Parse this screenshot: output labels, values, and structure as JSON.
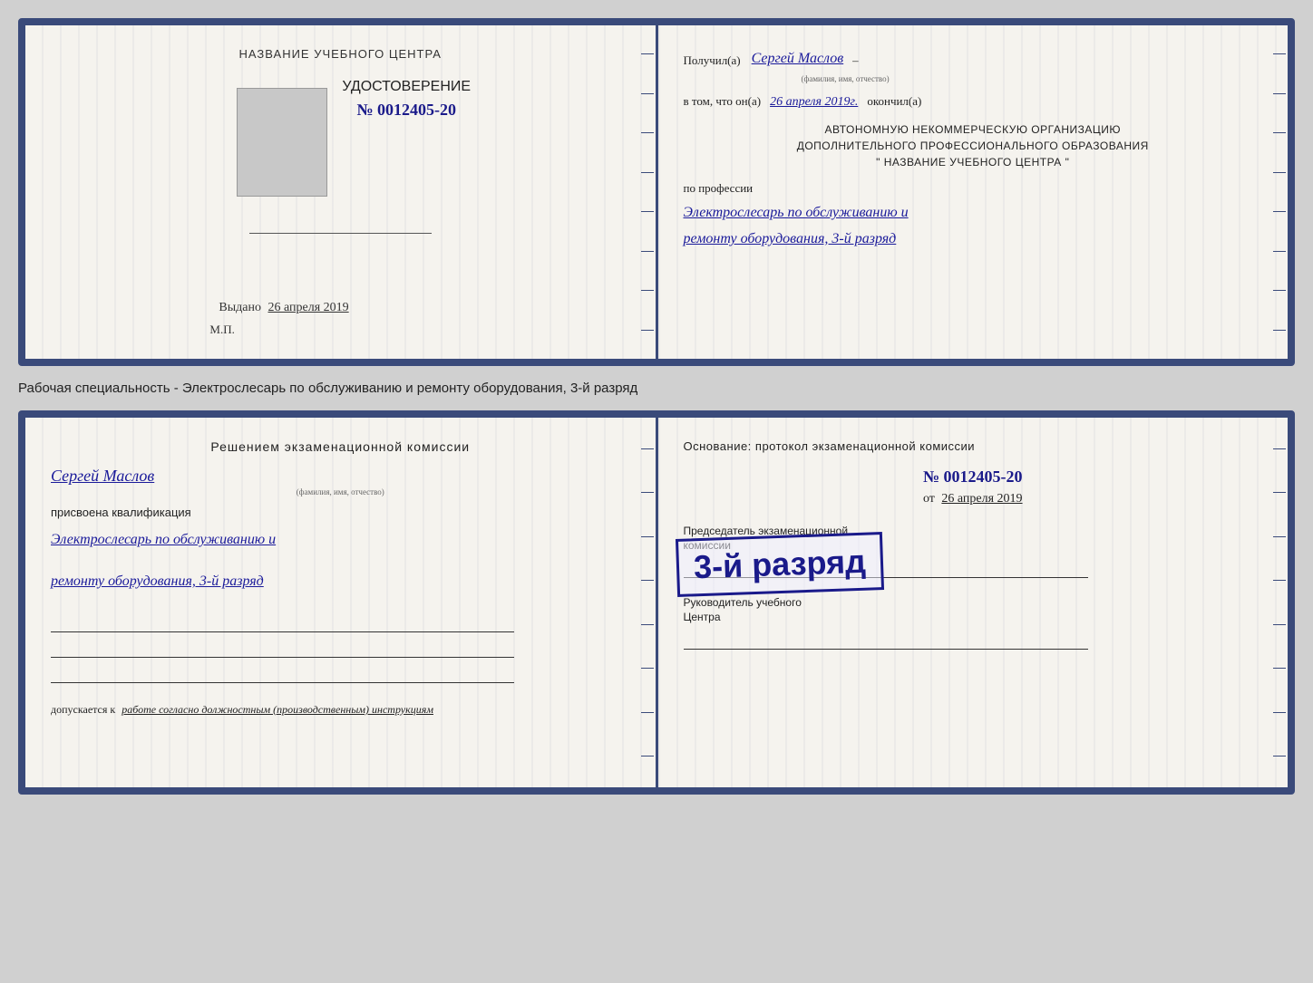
{
  "top_card": {
    "left": {
      "school_name": "НАЗВАНИЕ УЧЕБНОГО ЦЕНТРА",
      "udost_title": "УДОСТОВЕРЕНИЕ",
      "udost_number": "№ 0012405-20",
      "issued_label": "Выдано",
      "issued_date": "26 апреля 2019",
      "mp_label": "М.П."
    },
    "right": {
      "received_prefix": "Получил(а)",
      "recipient_name": "Сергей Маслов",
      "fio_sublabel": "(фамилия, имя, отчество)",
      "vtom_prefix": "в том, что он(а)",
      "vtom_date": "26 апреля 2019г.",
      "vtom_suffix": "окончил(а)",
      "org_line1": "АВТОНОМНУЮ НЕКОММЕРЧЕСКУЮ ОРГАНИЗАЦИЮ",
      "org_line2": "ДОПОЛНИТЕЛЬНОГО ПРОФЕССИОНАЛЬНОГО ОБРАЗОВАНИЯ",
      "org_line3": "\"    НАЗВАНИЕ УЧЕБНОГО ЦЕНТРА    \"",
      "po_professii": "по профессии",
      "profession_line1": "Электрослесарь по обслуживанию и",
      "profession_line2": "ремонту оборудования, 3-й разряд"
    }
  },
  "between_label": "Рабочая специальность - Электрослесарь по обслуживанию и ремонту оборудования, 3-й разряд",
  "bottom_card": {
    "left": {
      "decision_title": "Решением экзаменационной комиссии",
      "person_name": "Сергей Маслов",
      "fio_sublabel": "(фамилия, имя, отчество)",
      "assigned_text": "присвоена квалификация",
      "qualification_line1": "Электрослесарь по обслуживанию и",
      "qualification_line2": "ремонту оборудования, 3-й разряд",
      "допускается_label": "допускается к",
      "допускается_text": "работе согласно должностным (производственным) инструкциям"
    },
    "right": {
      "osnov_text": "Основание: протокол экзаменационной комиссии",
      "protocol_number": "№  0012405-20",
      "from_label": "от",
      "from_date": "26 апреля 2019",
      "stamp_text": "3-й разряд",
      "chairman_line1": "Председатель экзаменационной",
      "chairman_line2": "комиссии",
      "head_line1": "Руководитель учебного",
      "head_line2": "Центра"
    }
  }
}
